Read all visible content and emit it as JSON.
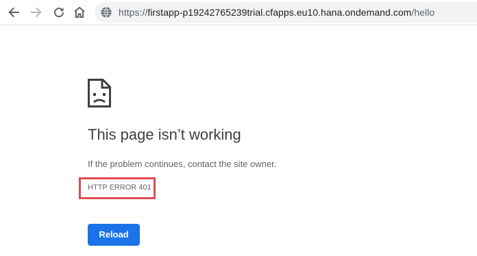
{
  "browser": {
    "icons": {
      "back": "arrow-left-icon",
      "forward": "arrow-right-icon",
      "reload": "reload-icon",
      "home": "home-icon",
      "site_info": "globe-icon"
    },
    "address_bar": {
      "scheme": "https://",
      "host": "firstapp-p19242765239trial.cfapps.eu10.hana.ondemand.com",
      "path": "/hello"
    }
  },
  "error_page": {
    "icon": "sad-document-icon",
    "title": "This page isn’t working",
    "description": "If the problem continues, contact the site owner.",
    "error_code": "HTTP ERROR 401",
    "reload_label": "Reload"
  },
  "colors": {
    "highlight_box": "#e04a4f",
    "primary_button": "#1a73e8",
    "title_text": "#3c4043",
    "body_text": "#5f6368"
  }
}
